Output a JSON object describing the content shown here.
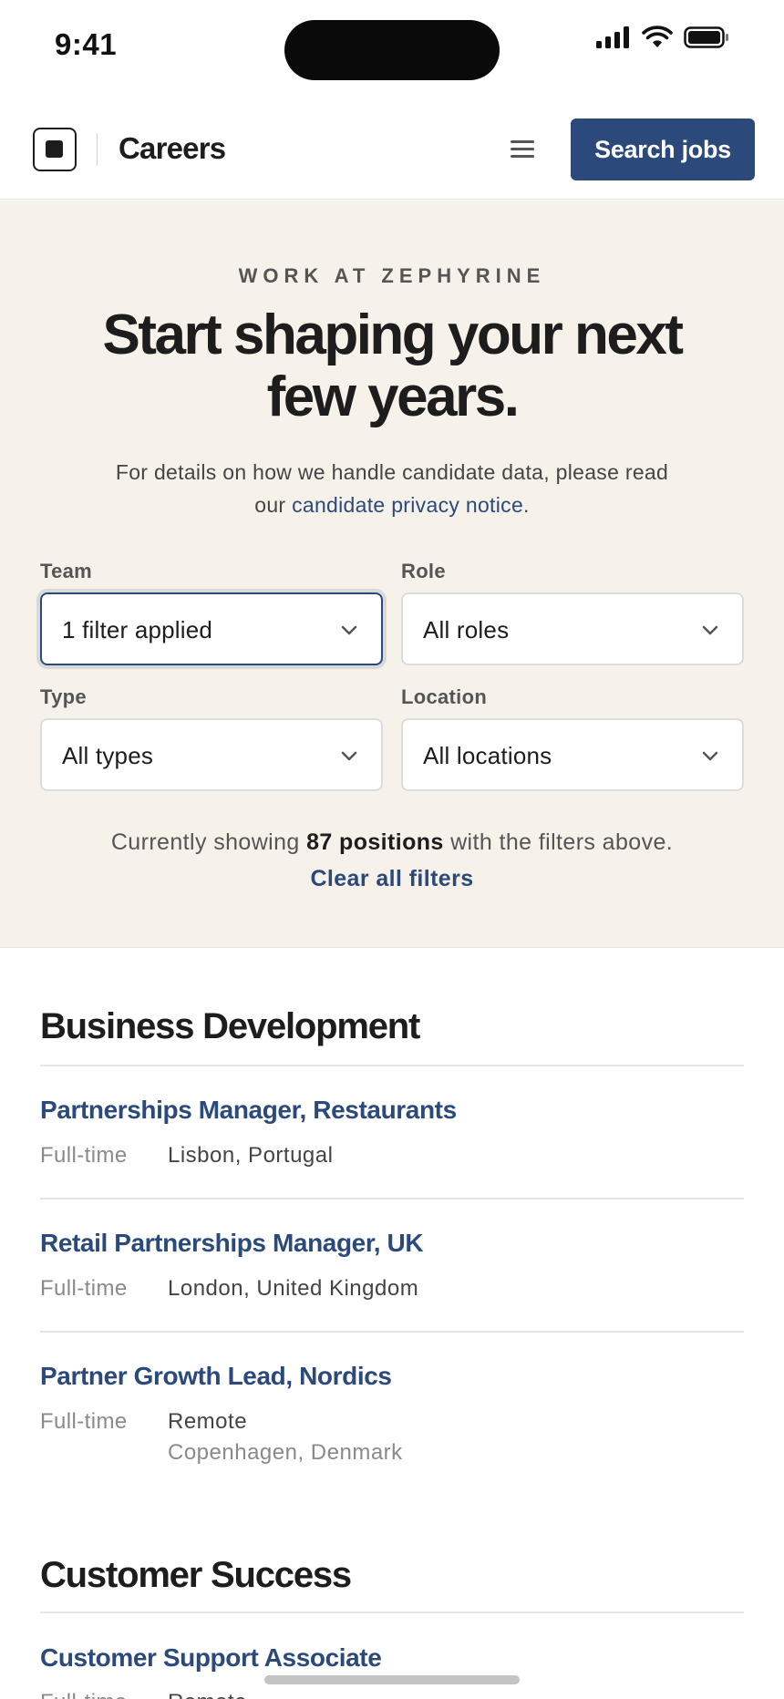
{
  "status_bar": {
    "time": "9:41"
  },
  "nav": {
    "title": "Careers",
    "search_label": "Search jobs"
  },
  "hero": {
    "eyebrow": "WORK AT ZEPHYRINE",
    "title": "Start shaping your next few years.",
    "desc_prefix": "For details on how we handle candidate data, please read our ",
    "desc_link": "candidate privacy notice",
    "desc_suffix": "."
  },
  "filters": {
    "team": {
      "label": "Team",
      "value": "1 filter applied"
    },
    "role": {
      "label": "Role",
      "value": "All roles"
    },
    "type": {
      "label": "Type",
      "value": "All types"
    },
    "location": {
      "label": "Location",
      "value": "All locations"
    }
  },
  "results": {
    "prefix": "Currently showing ",
    "count": "87 positions",
    "suffix": " with the filters above. ",
    "clear_label": "Clear all filters"
  },
  "sections": [
    {
      "title": "Business Development",
      "jobs": [
        {
          "title": "Partnerships Manager, Restaurants",
          "type": "Full-time",
          "location": "Lisbon, Portugal"
        },
        {
          "title": "Retail Partnerships Manager, UK",
          "type": "Full-time",
          "location": "London, United Kingdom"
        },
        {
          "title": "Partner Growth Lead, Nordics",
          "type": "Full-time",
          "location": "Remote",
          "location_secondary": "Copenhagen, Denmark"
        }
      ]
    },
    {
      "title": "Customer Success",
      "jobs": [
        {
          "title": "Customer Support Associate",
          "type": "Full-time",
          "location": "Remote"
        }
      ]
    }
  ],
  "colors": {
    "accent": "#2b4a7b",
    "hero_bg": "#f6f2ea",
    "text": "#1d1d1d"
  }
}
